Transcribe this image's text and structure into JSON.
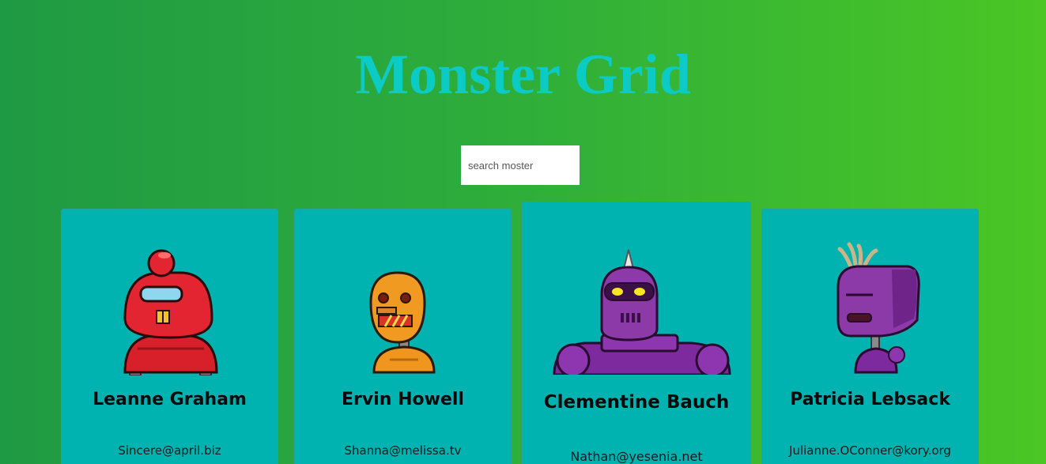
{
  "title": "Monster Grid",
  "search": {
    "placeholder": "search moster",
    "value": ""
  },
  "colors": {
    "card_background": "#00b2b0",
    "title": "#0ccac4",
    "background_start": "#1f9a44",
    "background_end": "#4bc625"
  },
  "monsters": [
    {
      "name": "Leanne Graham",
      "email": "Sincere@april.biz",
      "avatar_icon": "red-robot-avatar"
    },
    {
      "name": "Ervin Howell",
      "email": "Shanna@melissa.tv",
      "avatar_icon": "orange-robot-avatar"
    },
    {
      "name": "Clementine Bauch",
      "email": "Nathan@yesenia.net",
      "avatar_icon": "purple-robot-avatar"
    },
    {
      "name": "Patricia Lebsack",
      "email": "Julianne.OConner@kory.org",
      "avatar_icon": "purple-robot-avatar"
    }
  ]
}
